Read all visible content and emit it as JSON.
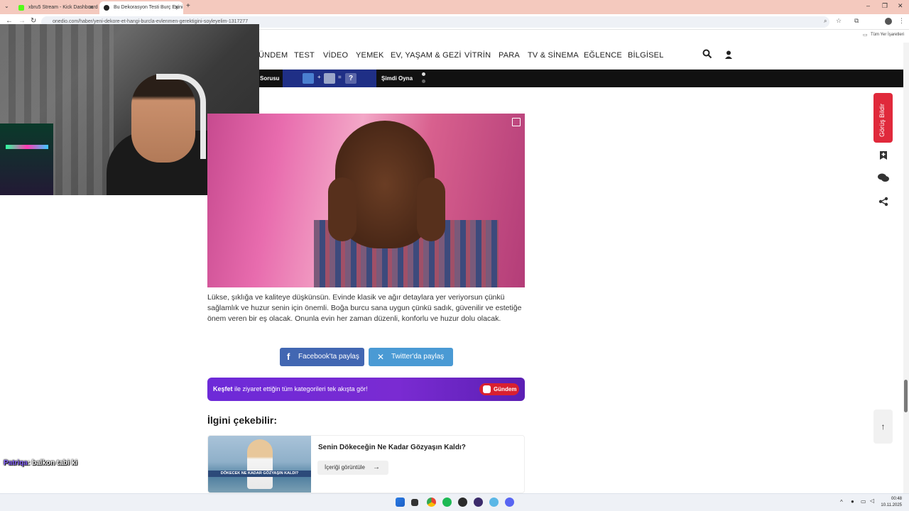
{
  "browser": {
    "tabs": [
      {
        "title": "xbru5 Stream - Kick Dashboard",
        "favicon_color": "#53fc18"
      },
      {
        "title": "Bu Dekorasyon Testi Burç Eşini",
        "favicon_color": "#222222"
      }
    ],
    "new_tab": "+",
    "url": "onedio.com/haber/yeni-dekore-et-hangi-burcla-evlenmen-gerektigini-soyleyelim-1317277",
    "bookmarks_label": "Tüm Yer İşaretleri"
  },
  "site_nav": {
    "items": [
      "ÜNDEM",
      "TEST",
      "VİDEO",
      "YEMEK",
      "EV, YAŞAM & GEZİ",
      "VİTRİN",
      "PARA",
      "TV & SİNEMA",
      "EĞLENCE",
      "BİLGİSEL"
    ]
  },
  "promo_strip": {
    "left_label": "Sorusu",
    "quiz_plus": "+",
    "quiz_equals": "=",
    "quiz_question": "?",
    "play_label": "Şimdi Oyna"
  },
  "article": {
    "body": "Lüksе, şıklığa ve kaliteye düşkünsün. Evinde klasik ve ağır detaylara yer veriyorsun çünkü sağlamlık ve huzur senin için önemli. Boğa burcu sana uygun çünkü sadık, güvenilir ve estetiğe önem veren bir eş olacak. Onunla evin her zaman düzenli, konforlu ve huzur dolu olacak.",
    "share_facebook": "Facebook'ta paylaş",
    "share_twitter": "Twitter'da paylaş",
    "kesfet_bold": "Keşfet",
    "kesfet_text": " ile ziyaret ettiğin tüm kategorileri tek akışta gör!",
    "gundem_label": "Gündem",
    "related_heading": "İlgini çekebilir:",
    "related_card": {
      "title": "Senin Dökeceğin Ne Kadar Gözyaşın Kaldı?",
      "thumb_caption": "DÖKECEK NE KADAR GÖZYAŞIN KALDI?",
      "button": "İçeriği görüntüle"
    }
  },
  "right_rail": {
    "feedback": "Görüş Bildir"
  },
  "chat": {
    "user": "Patriqa",
    "message": ": balkon tabi ki"
  },
  "taskbar": {
    "time": "00:48",
    "date": "10.11.2025"
  },
  "colors": {
    "facebook": "#4267b2",
    "twitter": "#4a9ad4",
    "feedback": "#e0293b",
    "kesfet": "#6d2ad8"
  }
}
